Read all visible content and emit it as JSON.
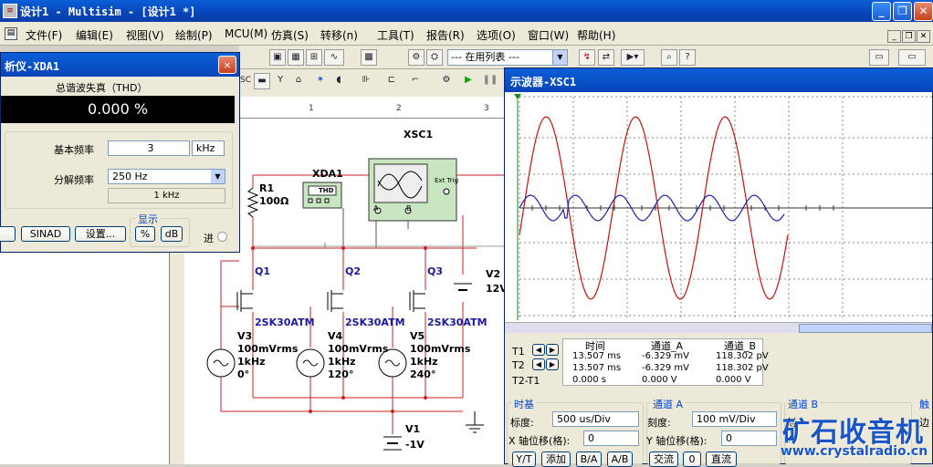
{
  "window": {
    "title": "设计1 - Multisim - [设计1 *]",
    "icon": "multisim-app-icon"
  },
  "menu": [
    "文件(F)",
    "编辑(E)",
    "视图(V)",
    "绘制(P)",
    "MCU(M)",
    "仿真(S)",
    "转移(n)",
    "工具(T)",
    "报告(R)",
    "选项(O)",
    "窗口(W)",
    "帮助(H)"
  ],
  "toolbar": {
    "in_use_list": "--- 在用列表 ---"
  },
  "distortion": {
    "title": "析仪-XDA1",
    "section": "总谐波失真（THD）",
    "value": "0.000 %",
    "fund_freq_label": "基本频率",
    "fund_freq_value": "3",
    "fund_freq_unit": "kHz",
    "resolution_label": "分解频率",
    "resolution_value": "250 Hz",
    "resolution_display": "1 kHz",
    "sinad_label": "SINAD",
    "settings_label": "设置...",
    "display_label": "显示",
    "percent_label": "%",
    "db_label": "dB",
    "jin_label": "进"
  },
  "schematic": {
    "ruler": [
      "1",
      "2",
      "3"
    ],
    "xsc_label": "XSC1",
    "xda_label": "XDA1",
    "thd_label": "THD",
    "ext_trig": "Ext Trig",
    "ch_a": "A",
    "ch_b": "B",
    "r1_name": "R1",
    "r1_value": "100Ω",
    "q1": "Q1",
    "q2": "Q2",
    "q3": "Q3",
    "fet": "2SK30ATM",
    "v2_name": "V2",
    "v2_value": "12V",
    "v3": [
      "V3",
      "100mVrms",
      "1kHz",
      "0°"
    ],
    "v4": [
      "V4",
      "100mVrms",
      "1kHz",
      "120°"
    ],
    "v5": [
      "V5",
      "100mVrms",
      "1kHz",
      "240°"
    ],
    "v1_name": "V1",
    "v1_value": "-1V"
  },
  "scope": {
    "title": "示波器-XSC1",
    "col_time": "时间",
    "col_cha": "通道_A",
    "col_chb": "通道_B",
    "t1": "T1",
    "t2": "T2",
    "t21": "T2-T1",
    "row1": [
      "13.507 ms",
      "-6.329 mV",
      "118.302 pV"
    ],
    "row2": [
      "13.507 ms",
      "-6.329 mV",
      "118.302 pV"
    ],
    "row3": [
      "0.000 s",
      "0.000 V",
      "0.000 V"
    ],
    "timebase": "时基",
    "scale_label": "标度:",
    "timebase_scale": "500 us/Div",
    "xpos_label": "X 轴位移(格):",
    "xpos_value": "0",
    "btn_yt": "Y/T",
    "btn_add": "添加",
    "btn_ba": "B/A",
    "btn_ab": "A/B",
    "cha_title": "通道 A",
    "scale2_label": "刻度:",
    "cha_scale": "100 mV/Div",
    "ypos_label": "Y 轴位移(格):",
    "ypos_value": "0",
    "btn_ac": "交流",
    "btn_0": "0",
    "btn_dc": "直流",
    "chb_title": "通道 B",
    "chb_label": "刻",
    "chb_ypos": "Y",
    "trigger_title": "触",
    "trig_label": "边"
  },
  "watermark": {
    "cn": "矿石收音机",
    "url": "www.crystalradio.cn"
  },
  "colors": {
    "titlebar": "#0a4fc8",
    "trace_a": "#cc1010",
    "trace_b": "#2020b0",
    "wire": "#cc2020"
  }
}
